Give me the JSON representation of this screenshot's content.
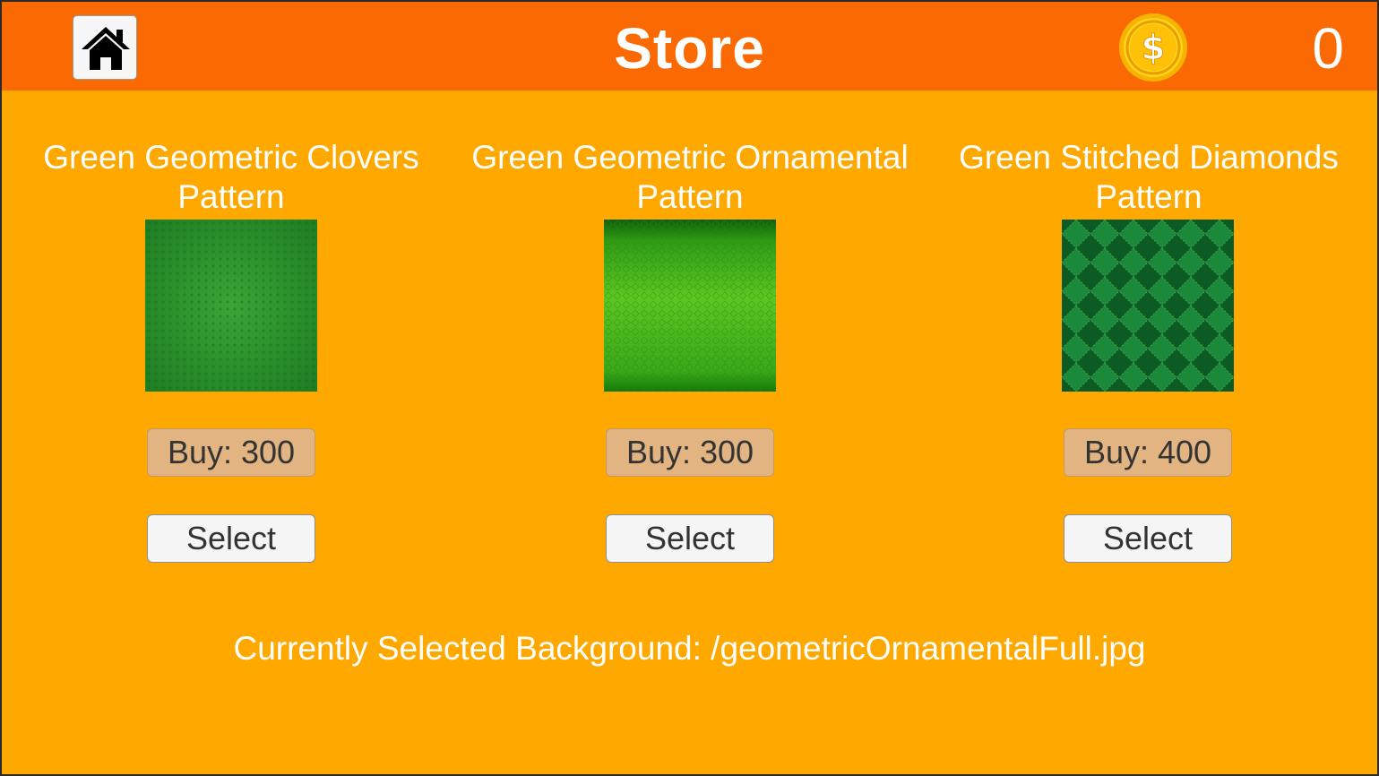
{
  "header": {
    "title": "Store",
    "coins": "0",
    "home_icon": "home-icon",
    "coin_icon": "dollar-coin-icon"
  },
  "items": [
    {
      "title": "Green Geometric Clovers Pattern",
      "buy_label": "Buy: 300",
      "select_label": "Select",
      "swatch_colors": [
        "#3aa536",
        "#1e7c22"
      ]
    },
    {
      "title": "Green Geometric Ornamental Pattern",
      "buy_label": "Buy: 300",
      "select_label": "Select",
      "swatch_colors": [
        "#5cc622",
        "#0e5e0c"
      ]
    },
    {
      "title": "Green Stitched Diamonds Pattern",
      "buy_label": "Buy: 400",
      "select_label": "Select",
      "swatch_colors": [
        "#1a8a3a",
        "#0c5a24"
      ]
    }
  ],
  "status": {
    "selected_text": "Currently Selected Background: /geometricOrnamentalFull.jpg"
  },
  "colors": {
    "header_bg": "#FB6A02",
    "page_bg": "#FFA800",
    "buy_button": "#E2B482",
    "select_button": "#f5f5f5"
  }
}
